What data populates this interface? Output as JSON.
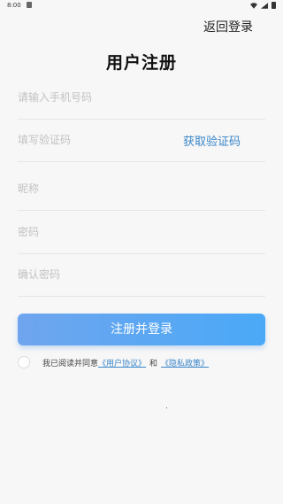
{
  "status_bar": {
    "time": "8:00"
  },
  "header": {
    "back_login": "返回登录",
    "title": "用户注册"
  },
  "form": {
    "phone_placeholder": "请输入手机号码",
    "code_placeholder": "填写验证码",
    "get_code_label": "获取验证码",
    "nickname_placeholder": "昵称",
    "password_placeholder": "密码",
    "confirm_password_placeholder": "确认密码",
    "submit_label": "注册并登录"
  },
  "agreement": {
    "prefix": "我已阅读并同意",
    "user_agreement": "《用户协议》",
    "and": "和",
    "privacy_policy": "《隐私政策》",
    "checked": false
  },
  "colors": {
    "accent": "#3a86c8",
    "button_gradient_start": "#6fa5ee",
    "button_gradient_end": "#4aa9f7"
  }
}
